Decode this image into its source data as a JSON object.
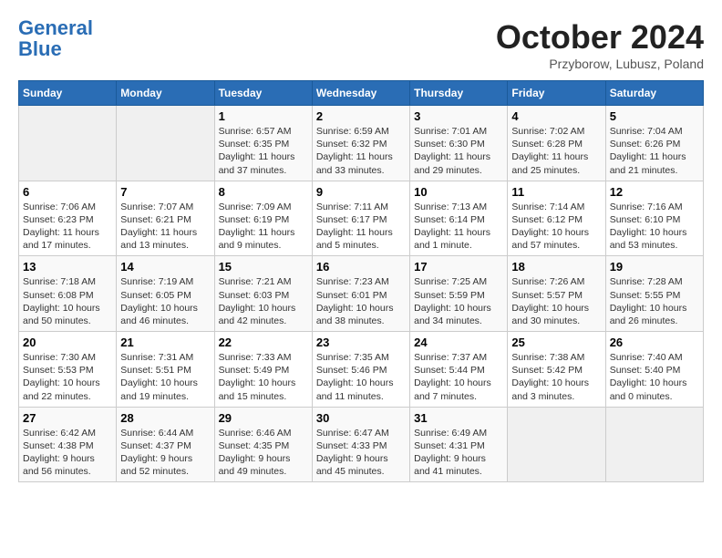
{
  "header": {
    "logo_line1": "General",
    "logo_line2": "Blue",
    "month_year": "October 2024",
    "location": "Przyborow, Lubusz, Poland"
  },
  "weekdays": [
    "Sunday",
    "Monday",
    "Tuesday",
    "Wednesday",
    "Thursday",
    "Friday",
    "Saturday"
  ],
  "weeks": [
    [
      {
        "day": "",
        "info": ""
      },
      {
        "day": "",
        "info": ""
      },
      {
        "day": "1",
        "info": "Sunrise: 6:57 AM\nSunset: 6:35 PM\nDaylight: 11 hours and 37 minutes."
      },
      {
        "day": "2",
        "info": "Sunrise: 6:59 AM\nSunset: 6:32 PM\nDaylight: 11 hours and 33 minutes."
      },
      {
        "day": "3",
        "info": "Sunrise: 7:01 AM\nSunset: 6:30 PM\nDaylight: 11 hours and 29 minutes."
      },
      {
        "day": "4",
        "info": "Sunrise: 7:02 AM\nSunset: 6:28 PM\nDaylight: 11 hours and 25 minutes."
      },
      {
        "day": "5",
        "info": "Sunrise: 7:04 AM\nSunset: 6:26 PM\nDaylight: 11 hours and 21 minutes."
      }
    ],
    [
      {
        "day": "6",
        "info": "Sunrise: 7:06 AM\nSunset: 6:23 PM\nDaylight: 11 hours and 17 minutes."
      },
      {
        "day": "7",
        "info": "Sunrise: 7:07 AM\nSunset: 6:21 PM\nDaylight: 11 hours and 13 minutes."
      },
      {
        "day": "8",
        "info": "Sunrise: 7:09 AM\nSunset: 6:19 PM\nDaylight: 11 hours and 9 minutes."
      },
      {
        "day": "9",
        "info": "Sunrise: 7:11 AM\nSunset: 6:17 PM\nDaylight: 11 hours and 5 minutes."
      },
      {
        "day": "10",
        "info": "Sunrise: 7:13 AM\nSunset: 6:14 PM\nDaylight: 11 hours and 1 minute."
      },
      {
        "day": "11",
        "info": "Sunrise: 7:14 AM\nSunset: 6:12 PM\nDaylight: 10 hours and 57 minutes."
      },
      {
        "day": "12",
        "info": "Sunrise: 7:16 AM\nSunset: 6:10 PM\nDaylight: 10 hours and 53 minutes."
      }
    ],
    [
      {
        "day": "13",
        "info": "Sunrise: 7:18 AM\nSunset: 6:08 PM\nDaylight: 10 hours and 50 minutes."
      },
      {
        "day": "14",
        "info": "Sunrise: 7:19 AM\nSunset: 6:05 PM\nDaylight: 10 hours and 46 minutes."
      },
      {
        "day": "15",
        "info": "Sunrise: 7:21 AM\nSunset: 6:03 PM\nDaylight: 10 hours and 42 minutes."
      },
      {
        "day": "16",
        "info": "Sunrise: 7:23 AM\nSunset: 6:01 PM\nDaylight: 10 hours and 38 minutes."
      },
      {
        "day": "17",
        "info": "Sunrise: 7:25 AM\nSunset: 5:59 PM\nDaylight: 10 hours and 34 minutes."
      },
      {
        "day": "18",
        "info": "Sunrise: 7:26 AM\nSunset: 5:57 PM\nDaylight: 10 hours and 30 minutes."
      },
      {
        "day": "19",
        "info": "Sunrise: 7:28 AM\nSunset: 5:55 PM\nDaylight: 10 hours and 26 minutes."
      }
    ],
    [
      {
        "day": "20",
        "info": "Sunrise: 7:30 AM\nSunset: 5:53 PM\nDaylight: 10 hours and 22 minutes."
      },
      {
        "day": "21",
        "info": "Sunrise: 7:31 AM\nSunset: 5:51 PM\nDaylight: 10 hours and 19 minutes."
      },
      {
        "day": "22",
        "info": "Sunrise: 7:33 AM\nSunset: 5:49 PM\nDaylight: 10 hours and 15 minutes."
      },
      {
        "day": "23",
        "info": "Sunrise: 7:35 AM\nSunset: 5:46 PM\nDaylight: 10 hours and 11 minutes."
      },
      {
        "day": "24",
        "info": "Sunrise: 7:37 AM\nSunset: 5:44 PM\nDaylight: 10 hours and 7 minutes."
      },
      {
        "day": "25",
        "info": "Sunrise: 7:38 AM\nSunset: 5:42 PM\nDaylight: 10 hours and 3 minutes."
      },
      {
        "day": "26",
        "info": "Sunrise: 7:40 AM\nSunset: 5:40 PM\nDaylight: 10 hours and 0 minutes."
      }
    ],
    [
      {
        "day": "27",
        "info": "Sunrise: 6:42 AM\nSunset: 4:38 PM\nDaylight: 9 hours and 56 minutes."
      },
      {
        "day": "28",
        "info": "Sunrise: 6:44 AM\nSunset: 4:37 PM\nDaylight: 9 hours and 52 minutes."
      },
      {
        "day": "29",
        "info": "Sunrise: 6:46 AM\nSunset: 4:35 PM\nDaylight: 9 hours and 49 minutes."
      },
      {
        "day": "30",
        "info": "Sunrise: 6:47 AM\nSunset: 4:33 PM\nDaylight: 9 hours and 45 minutes."
      },
      {
        "day": "31",
        "info": "Sunrise: 6:49 AM\nSunset: 4:31 PM\nDaylight: 9 hours and 41 minutes."
      },
      {
        "day": "",
        "info": ""
      },
      {
        "day": "",
        "info": ""
      }
    ]
  ]
}
